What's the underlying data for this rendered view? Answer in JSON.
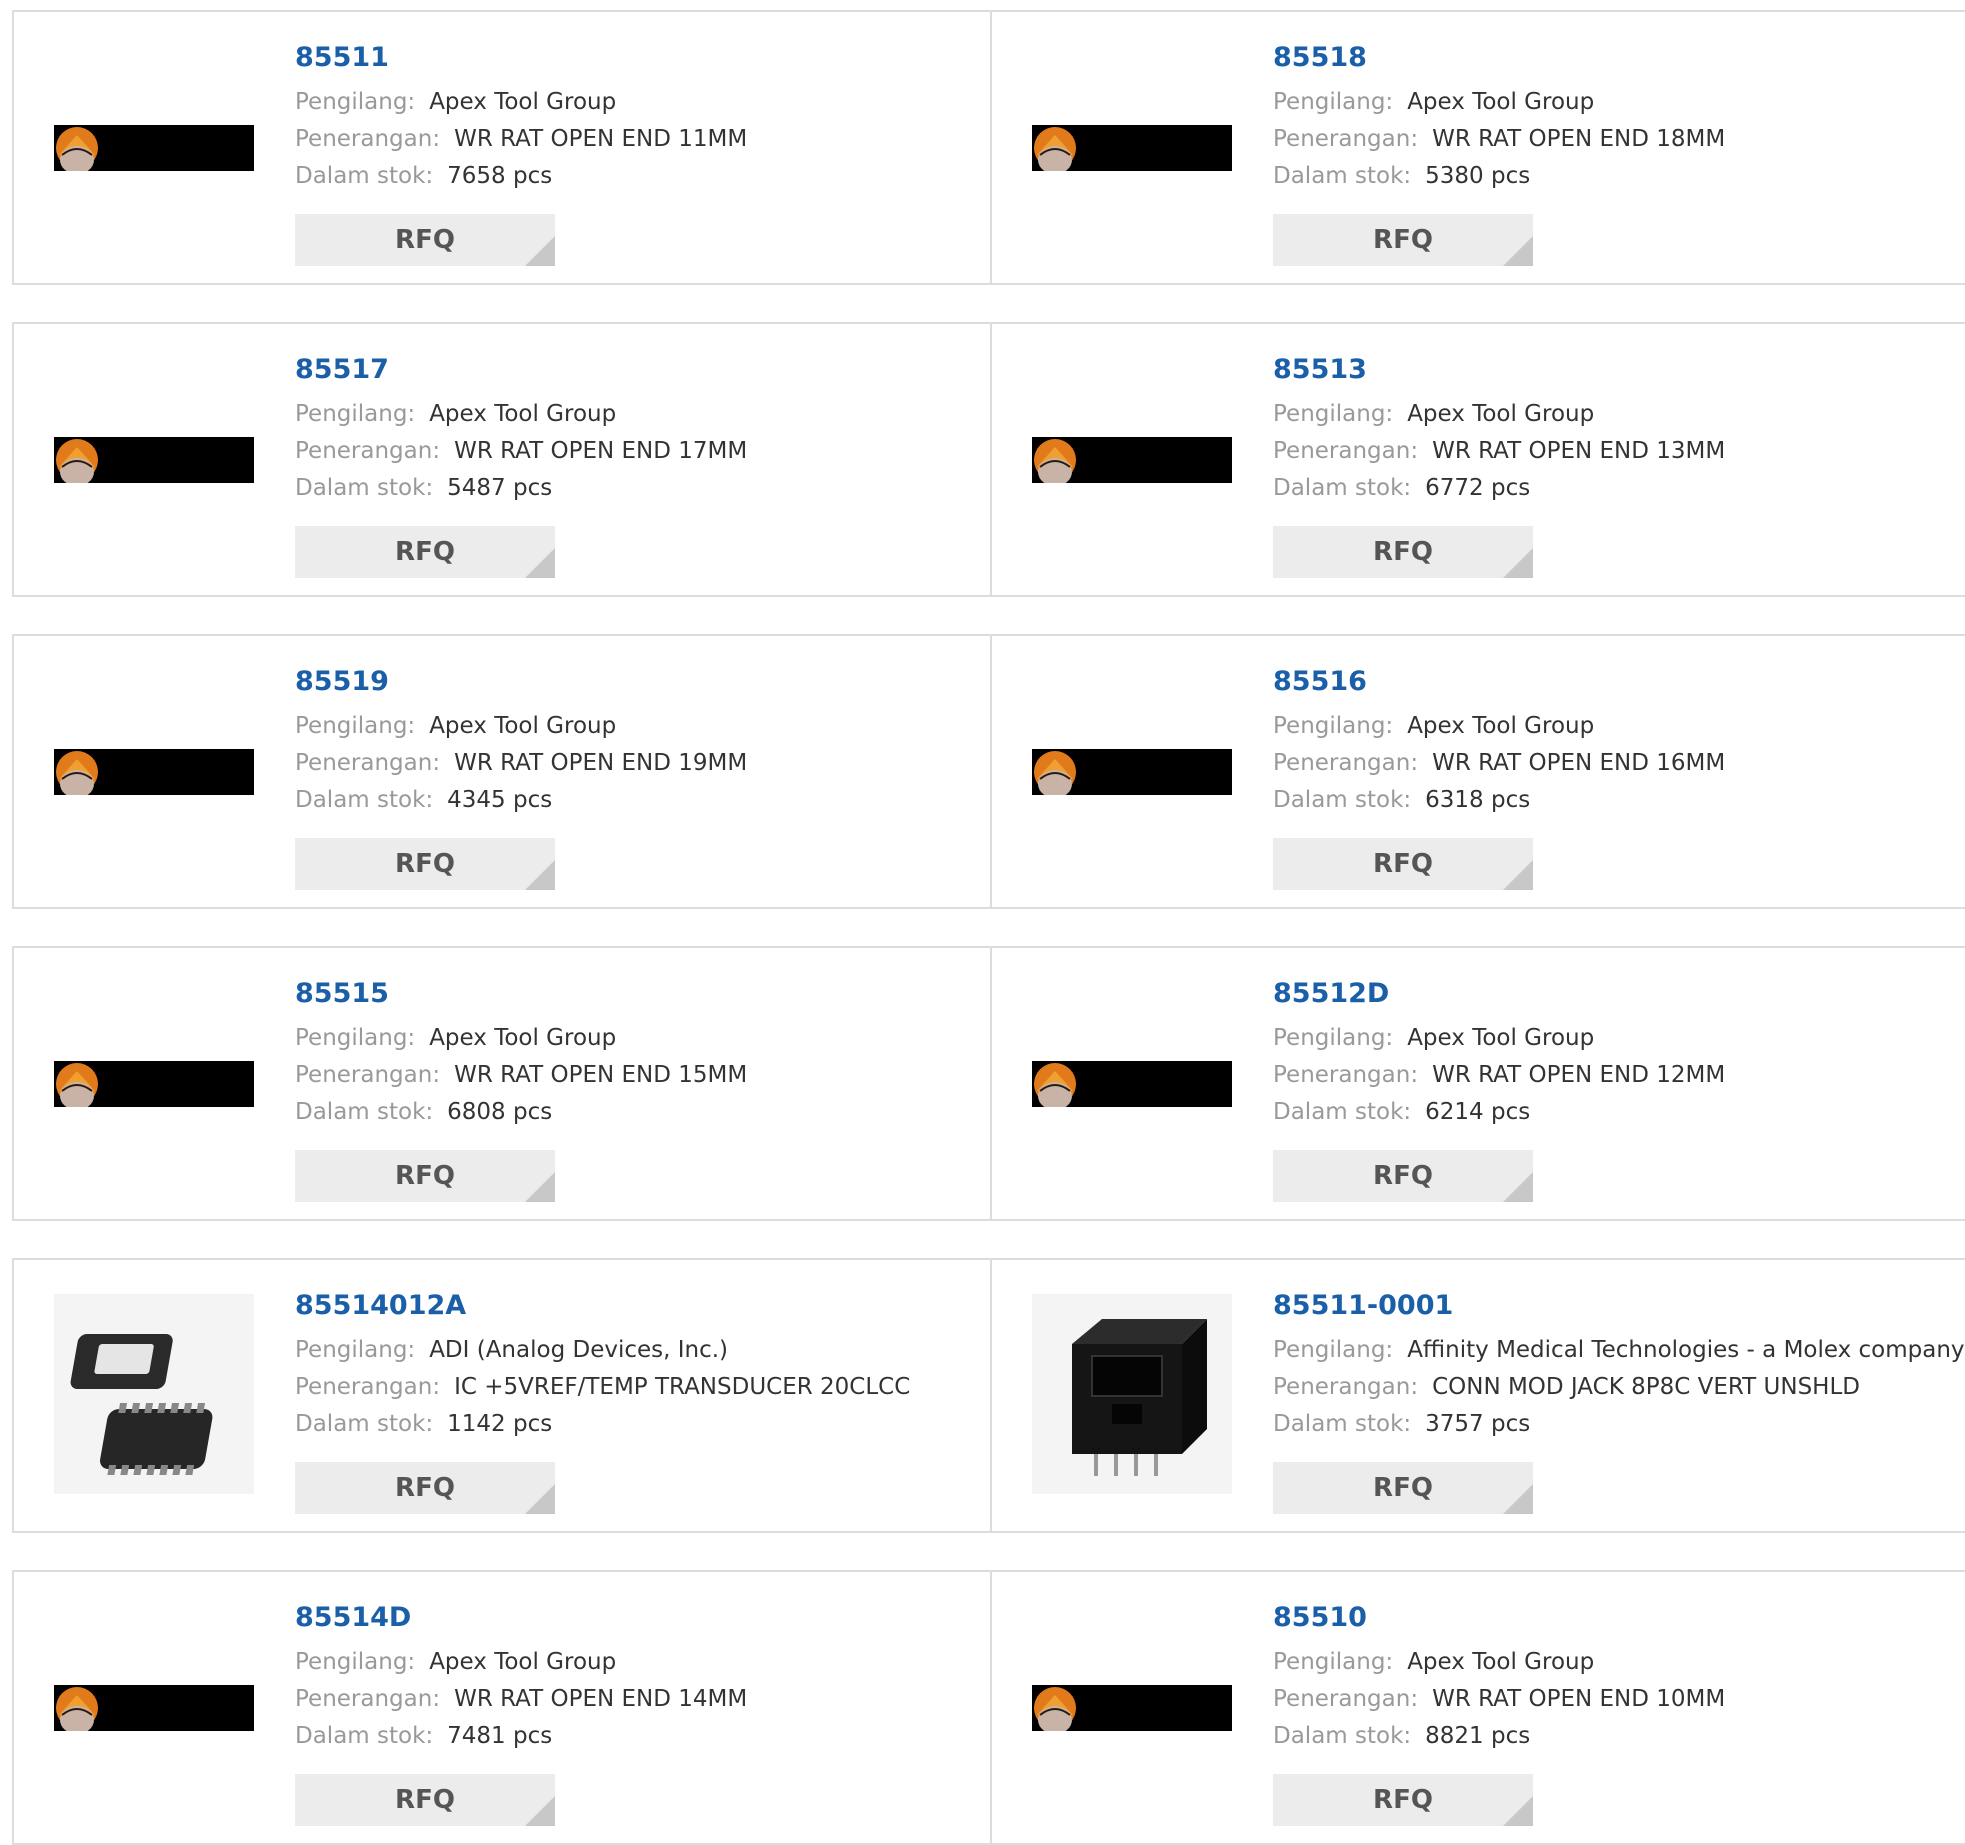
{
  "labels": {
    "manufacturer": "Pengilang:",
    "description": "Penerangan:",
    "stock": "Dalam stok:",
    "rfq": "RFQ"
  },
  "rows": [
    {
      "left": {
        "part": "85511",
        "manufacturer": "Apex Tool Group",
        "description": "WR RAT OPEN END 11MM",
        "stock": "7658 pcs",
        "image": "apex-tool-group-logo"
      },
      "right": {
        "part": "85518",
        "manufacturer": "Apex Tool Group",
        "description": "WR RAT OPEN END 18MM",
        "stock": "5380 pcs",
        "image": "apex-tool-group-logo"
      }
    },
    {
      "left": {
        "part": "85517",
        "manufacturer": "Apex Tool Group",
        "description": "WR RAT OPEN END 17MM",
        "stock": "5487 pcs",
        "image": "apex-tool-group-logo"
      },
      "right": {
        "part": "85513",
        "manufacturer": "Apex Tool Group",
        "description": "WR RAT OPEN END 13MM",
        "stock": "6772 pcs",
        "image": "apex-tool-group-logo"
      }
    },
    {
      "left": {
        "part": "85519",
        "manufacturer": "Apex Tool Group",
        "description": "WR RAT OPEN END 19MM",
        "stock": "4345 pcs",
        "image": "apex-tool-group-logo"
      },
      "right": {
        "part": "85516",
        "manufacturer": "Apex Tool Group",
        "description": "WR RAT OPEN END 16MM",
        "stock": "6318 pcs",
        "image": "apex-tool-group-logo"
      }
    },
    {
      "left": {
        "part": "85515",
        "manufacturer": "Apex Tool Group",
        "description": "WR RAT OPEN END 15MM",
        "stock": "6808 pcs",
        "image": "apex-tool-group-logo"
      },
      "right": {
        "part": "85512D",
        "manufacturer": "Apex Tool Group",
        "description": "WR RAT OPEN END 12MM",
        "stock": "6214 pcs",
        "image": "apex-tool-group-logo"
      }
    },
    {
      "left": {
        "part": "85514012A",
        "manufacturer": "ADI (Analog Devices, Inc.)",
        "description": "IC +5VREF/TEMP TRANSDUCER 20CLCC",
        "stock": "1142 pcs",
        "image": "lcc-chip-photo"
      },
      "right": {
        "part": "85511-0001",
        "manufacturer": "Affinity Medical Technologies - a Molex company",
        "description": "CONN MOD JACK 8P8C VERT UNSHLD",
        "stock": "3757 pcs",
        "image": "modular-jack-photo"
      }
    },
    {
      "left": {
        "part": "85514D",
        "manufacturer": "Apex Tool Group",
        "description": "WR RAT OPEN END 14MM",
        "stock": "7481 pcs",
        "image": "apex-tool-group-logo"
      },
      "right": {
        "part": "85510",
        "manufacturer": "Apex Tool Group",
        "description": "WR RAT OPEN END 10MM",
        "stock": "8821 pcs",
        "image": "apex-tool-group-logo"
      }
    }
  ]
}
